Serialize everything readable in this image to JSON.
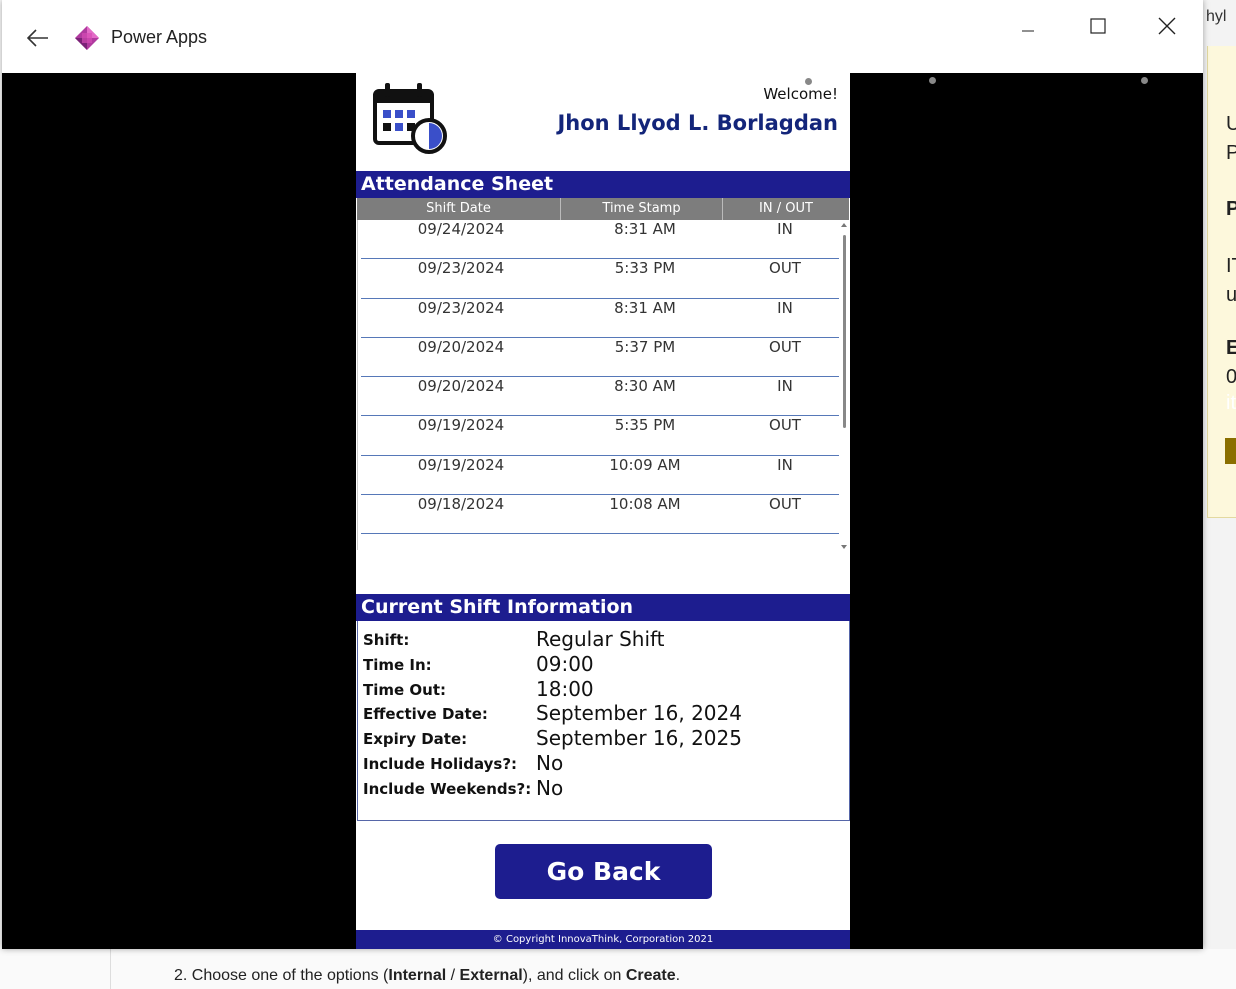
{
  "window": {
    "title": "Power Apps"
  },
  "background": {
    "tab_text": "hyl",
    "note_lines": [
      "U",
      "P",
      "P",
      "IT",
      "u",
      "E",
      "0",
      "it"
    ],
    "step_prefix": "2. Choose one of the options (",
    "step_internal": "Internal",
    "step_sep": " / ",
    "step_external": "External",
    "step_mid": "), and click on ",
    "step_create": "Create",
    "step_end": "."
  },
  "header": {
    "welcome": "Welcome!",
    "user_name": "Jhon Llyod L. Borlagdan"
  },
  "attendance": {
    "title": "Attendance Sheet",
    "columns": [
      "Shift Date",
      "Time Stamp",
      "IN / OUT"
    ],
    "rows": [
      {
        "date": "09/24/2024",
        "time": "8:31 AM",
        "dir": "IN"
      },
      {
        "date": "09/23/2024",
        "time": "5:33 PM",
        "dir": "OUT"
      },
      {
        "date": "09/23/2024",
        "time": "8:31 AM",
        "dir": "IN"
      },
      {
        "date": "09/20/2024",
        "time": "5:37 PM",
        "dir": "OUT"
      },
      {
        "date": "09/20/2024",
        "time": "8:30 AM",
        "dir": "IN"
      },
      {
        "date": "09/19/2024",
        "time": "5:35 PM",
        "dir": "OUT"
      },
      {
        "date": "09/19/2024",
        "time": "10:09 AM",
        "dir": "IN"
      },
      {
        "date": "09/18/2024",
        "time": "10:08 AM",
        "dir": "OUT"
      }
    ]
  },
  "shift": {
    "title": "Current Shift Information",
    "fields": [
      {
        "label": "Shift:",
        "value": "Regular Shift"
      },
      {
        "label": "Time In:",
        "value": "09:00"
      },
      {
        "label": "Time Out:",
        "value": "18:00"
      },
      {
        "label": "Effective Date:",
        "value": "September 16, 2024"
      },
      {
        "label": "Expiry Date:",
        "value": "September 16, 2025"
      },
      {
        "label": "Include Holidays?:",
        "value": "No"
      },
      {
        "label": "Include Weekends?:",
        "value": "No"
      }
    ]
  },
  "actions": {
    "go_back_label": "Go Back"
  },
  "footer": {
    "copyright": "© Copyright InnovaThink, Corporation 2021"
  },
  "colors": {
    "primary": "#1d1d8f",
    "name_color": "#13257a",
    "row_separator": "#5678b8"
  }
}
